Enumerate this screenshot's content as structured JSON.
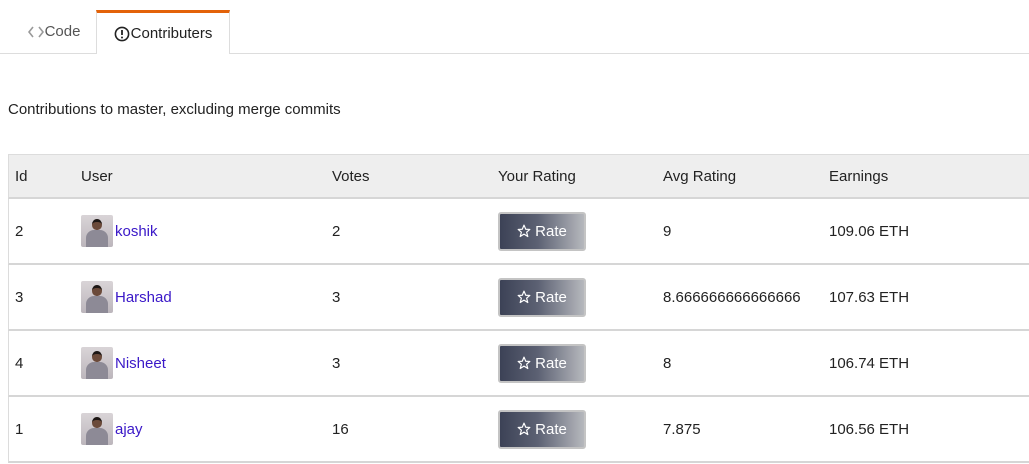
{
  "tabs": [
    {
      "label": "Code",
      "icon": "code-icon",
      "active": false
    },
    {
      "label": "Contributers",
      "icon": "alert-circle-icon",
      "active": true
    }
  ],
  "accent_color": "#e36209",
  "subtitle": "Contributions to master, excluding merge commits",
  "table": {
    "headers": {
      "id": "Id",
      "user": "User",
      "votes": "Votes",
      "your_rating": "Your Rating",
      "avg_rating": "Avg Rating",
      "earnings": "Earnings"
    },
    "rate_label": "Rate",
    "rows": [
      {
        "id": "2",
        "user": "koshik",
        "votes": "2",
        "avg": "9",
        "earnings": "109.06 ETH"
      },
      {
        "id": "3",
        "user": "Harshad",
        "votes": "3",
        "avg": "8.666666666666666",
        "earnings": "107.63 ETH"
      },
      {
        "id": "4",
        "user": "Nisheet",
        "votes": "3",
        "avg": "8",
        "earnings": "106.74 ETH"
      },
      {
        "id": "1",
        "user": "ajay",
        "votes": "16",
        "avg": "7.875",
        "earnings": "106.56 ETH"
      }
    ]
  }
}
